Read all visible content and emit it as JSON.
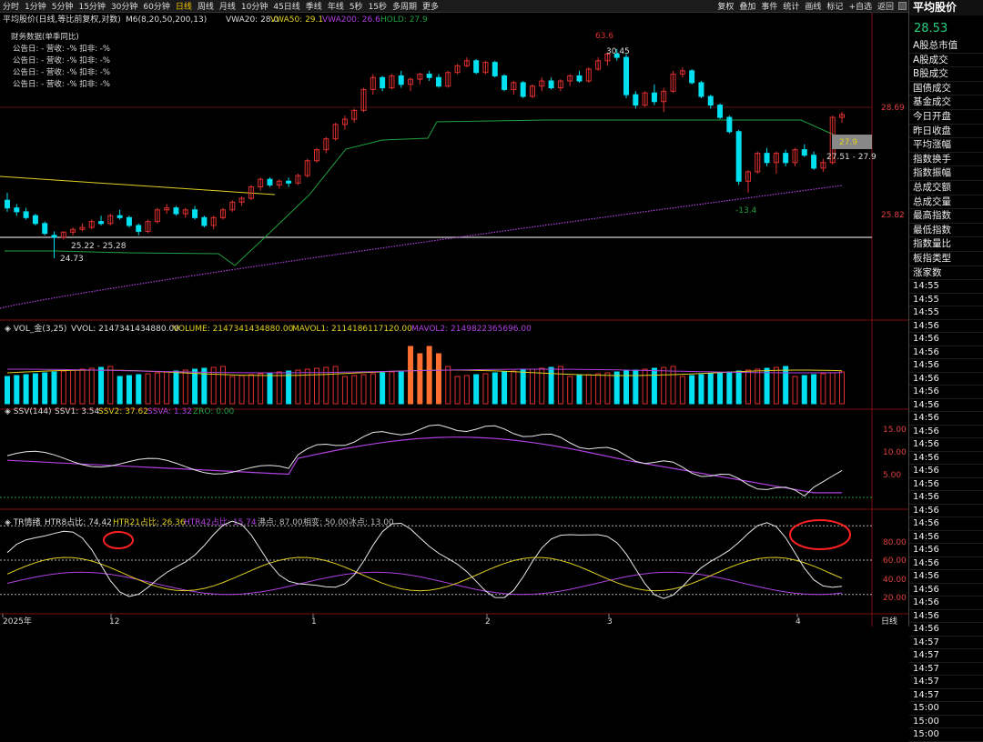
{
  "toolbar": {
    "periods": [
      {
        "label": "分时",
        "active": false
      },
      {
        "label": "1分钟",
        "active": false
      },
      {
        "label": "5分钟",
        "active": false
      },
      {
        "label": "15分钟",
        "active": false
      },
      {
        "label": "30分钟",
        "active": false
      },
      {
        "label": "60分钟",
        "active": false
      },
      {
        "label": "日线",
        "active": true
      },
      {
        "label": "周线",
        "active": false
      },
      {
        "label": "月线",
        "active": false
      },
      {
        "label": "10分钟",
        "active": false
      },
      {
        "label": "45日线",
        "active": false
      },
      {
        "label": "季线",
        "active": false
      },
      {
        "label": "年线",
        "active": false
      },
      {
        "label": "5秒",
        "active": false
      },
      {
        "label": "15秒",
        "active": false
      },
      {
        "label": "多周期",
        "active": false
      },
      {
        "label": "更多",
        "active": false
      }
    ],
    "tools": [
      "复权",
      "叠加",
      "事件",
      "统计",
      "画线",
      "标记",
      "+自选",
      "返回"
    ]
  },
  "main_panel": {
    "title": "平均股价(日线,等比前复权,对数)",
    "m6": "M6(8,20,50,200,13)",
    "vwa20": "VWA20: 28.0",
    "vwa50": "VWA50: 29.1",
    "vwa200": "VWA200: 26.6",
    "hold": "HOLD: 27.9",
    "fin_title": "财务数据(单季同比)",
    "fin_rows": [
      "公告日: -    营收: -%    扣非: -%",
      "公告日: -    营收: -%    扣非: -%",
      "公告日: -    营收: -%    扣非: -%",
      "公告日: -    营收: -%    扣非: -%"
    ],
    "ann_high_pct": "63.6",
    "ann_high": "30.45",
    "ann_low": "24.73",
    "ann_range1": "25.22 - 25.28",
    "ann_range2": "27.51 - 27.9",
    "ann_neg": "-13.4",
    "hold_tag": "27.9",
    "y_labels": [
      "28.69",
      "25.82"
    ]
  },
  "vol_panel": {
    "title": "VOL_金(3,25)",
    "vvol": "VVOL: 2147341434880.00",
    "volume": "VOLUME: 2147341434880.00",
    "mavol1": "MAVOL1: 2114186117120.00",
    "mavol2": "MAVOL2: 2149822365696.00"
  },
  "ssv_panel": {
    "title": "SSV(144)",
    "ssv1": "SSV1: 3.54",
    "ssv2": "SSV2: 37.62",
    "ssva": "SSVA: 1.32",
    "zro": "ZRO: 0.00",
    "y_labels": [
      "15.00",
      "10.00",
      "5.00"
    ]
  },
  "tr_panel": {
    "title": "TR情绪",
    "htr8": "HTR8占比: 74.42",
    "htr21": "HTR21占比: 26.36",
    "htr42": "HTR42占比: 15.74",
    "hot": "沸点: 87.00",
    "norm": "相变: 50.00",
    "ice": "冰点: 13.00",
    "y_labels": [
      "80.00",
      "60.00",
      "40.00",
      "20.00"
    ]
  },
  "x_axis": {
    "labels": [
      "2025年",
      "12",
      "1",
      "2",
      "3",
      "4"
    ],
    "period_label": "日线"
  },
  "colors": {
    "up": "#e03030",
    "down": "#00e0f0",
    "vwa20": "#20a040",
    "vwa50": "#e0d020",
    "vwa200": "#b040e0",
    "hold": "#d0d0d0",
    "highlight": "#ff7030",
    "circle": "#ff2020"
  },
  "right_panel": {
    "title": "平均股价",
    "price": "28.53",
    "items": [
      "A股总市值",
      "A股成交",
      "B股成交",
      "国债成交",
      "基金成交",
      "今日开盘",
      "昨日收盘",
      "平均涨幅",
      "指数换手",
      "指数振幅",
      "总成交额",
      "总成交量",
      "最高指数",
      "最低指数",
      "指数量比",
      "板指类型",
      "涨家数"
    ],
    "times": [
      "14:55",
      "14:55",
      "14:55",
      "14:56",
      "14:56",
      "14:56",
      "14:56",
      "14:56",
      "14:56",
      "14:56",
      "14:56",
      "14:56",
      "14:56",
      "14:56",
      "14:56",
      "14:56",
      "14:56",
      "14:56",
      "14:56",
      "14:56",
      "14:56",
      "14:56",
      "14:56",
      "14:56",
      "14:56",
      "14:56",
      "14:56",
      "14:57",
      "14:57",
      "14:57",
      "14:57",
      "14:57",
      "15:00",
      "15:00",
      "15:00"
    ]
  },
  "chart_data": {
    "type": "candlestick",
    "series": [
      {
        "name": "K",
        "ohlc": [
          [
            26.2,
            26.4,
            25.9,
            26.0
          ],
          [
            26.0,
            26.1,
            25.8,
            25.9
          ],
          [
            25.9,
            26.0,
            25.7,
            25.75
          ],
          [
            25.8,
            25.85,
            25.55,
            25.6
          ],
          [
            25.6,
            25.65,
            25.3,
            25.35
          ],
          [
            25.3,
            25.4,
            24.73,
            25.25
          ],
          [
            25.25,
            25.4,
            25.2,
            25.38
          ],
          [
            25.38,
            25.5,
            25.3,
            25.45
          ],
          [
            25.45,
            25.6,
            25.4,
            25.5
          ],
          [
            25.5,
            25.7,
            25.45,
            25.65
          ],
          [
            25.65,
            25.8,
            25.55,
            25.6
          ],
          [
            25.6,
            25.85,
            25.55,
            25.8
          ],
          [
            25.8,
            25.95,
            25.7,
            25.75
          ],
          [
            25.75,
            25.8,
            25.5,
            25.55
          ],
          [
            25.55,
            25.6,
            25.3,
            25.4
          ],
          [
            25.4,
            25.7,
            25.35,
            25.65
          ],
          [
            25.65,
            26.0,
            25.6,
            25.95
          ],
          [
            25.95,
            26.1,
            25.85,
            26.0
          ],
          [
            26.0,
            26.05,
            25.8,
            25.85
          ],
          [
            25.85,
            26.0,
            25.75,
            25.95
          ],
          [
            25.95,
            26.05,
            25.7,
            25.75
          ],
          [
            25.75,
            25.8,
            25.5,
            25.55
          ],
          [
            25.55,
            25.8,
            25.45,
            25.75
          ],
          [
            25.75,
            26.0,
            25.7,
            25.95
          ],
          [
            25.95,
            26.2,
            25.9,
            26.15
          ],
          [
            26.15,
            26.3,
            26.05,
            26.25
          ],
          [
            26.25,
            26.6,
            26.2,
            26.55
          ],
          [
            26.55,
            26.8,
            26.45,
            26.75
          ],
          [
            26.75,
            26.8,
            26.55,
            26.6
          ],
          [
            26.6,
            26.75,
            26.5,
            26.7
          ],
          [
            26.7,
            26.8,
            26.55,
            26.65
          ],
          [
            26.65,
            26.9,
            26.6,
            26.85
          ],
          [
            26.85,
            27.3,
            26.8,
            27.25
          ],
          [
            27.25,
            27.6,
            27.2,
            27.55
          ],
          [
            27.55,
            27.9,
            27.45,
            27.85
          ],
          [
            27.85,
            28.3,
            27.8,
            28.25
          ],
          [
            28.25,
            28.5,
            28.1,
            28.4
          ],
          [
            28.4,
            28.7,
            28.3,
            28.65
          ],
          [
            28.65,
            29.3,
            28.6,
            29.25
          ],
          [
            29.25,
            29.7,
            29.1,
            29.6
          ],
          [
            29.6,
            29.65,
            29.2,
            29.3
          ],
          [
            29.3,
            29.7,
            29.25,
            29.65
          ],
          [
            29.65,
            29.8,
            29.3,
            29.4
          ],
          [
            29.4,
            29.6,
            29.2,
            29.55
          ],
          [
            29.55,
            29.75,
            29.4,
            29.7
          ],
          [
            29.7,
            29.8,
            29.5,
            29.6
          ],
          [
            29.6,
            29.7,
            29.3,
            29.35
          ],
          [
            29.35,
            29.8,
            29.3,
            29.75
          ],
          [
            29.75,
            30.0,
            29.7,
            29.95
          ],
          [
            29.95,
            30.2,
            29.9,
            30.1
          ],
          [
            30.1,
            30.15,
            29.7,
            29.75
          ],
          [
            29.75,
            30.1,
            29.7,
            30.05
          ],
          [
            30.05,
            30.1,
            29.6,
            29.65
          ],
          [
            29.65,
            29.7,
            29.2,
            29.25
          ],
          [
            29.25,
            29.5,
            29.1,
            29.45
          ],
          [
            29.45,
            29.5,
            29.0,
            29.05
          ],
          [
            29.05,
            29.4,
            29.0,
            29.35
          ],
          [
            29.35,
            29.6,
            29.2,
            29.5
          ],
          [
            29.5,
            29.6,
            29.25,
            29.3
          ],
          [
            29.3,
            29.55,
            29.2,
            29.5
          ],
          [
            29.5,
            29.7,
            29.35,
            29.65
          ],
          [
            29.65,
            29.8,
            29.45,
            29.5
          ],
          [
            29.5,
            29.9,
            29.45,
            29.85
          ],
          [
            29.85,
            30.2,
            29.8,
            30.1
          ],
          [
            30.1,
            30.35,
            29.95,
            30.3
          ],
          [
            30.3,
            30.45,
            30.1,
            30.2
          ],
          [
            30.2,
            30.3,
            29.0,
            29.1
          ],
          [
            29.1,
            29.2,
            28.7,
            28.8
          ],
          [
            28.8,
            29.2,
            28.75,
            29.15
          ],
          [
            29.15,
            29.4,
            28.8,
            28.9
          ],
          [
            28.9,
            29.3,
            28.6,
            29.2
          ],
          [
            29.2,
            29.8,
            29.15,
            29.7
          ],
          [
            29.7,
            29.9,
            29.6,
            29.8
          ],
          [
            29.8,
            29.85,
            29.4,
            29.45
          ],
          [
            29.45,
            29.5,
            29.0,
            29.05
          ],
          [
            29.05,
            29.1,
            28.7,
            28.8
          ],
          [
            28.8,
            28.85,
            28.4,
            28.45
          ],
          [
            28.45,
            28.5,
            28.0,
            28.05
          ],
          [
            28.05,
            28.1,
            26.6,
            26.7
          ],
          [
            26.7,
            27.0,
            26.4,
            26.95
          ],
          [
            26.95,
            27.5,
            26.9,
            27.45
          ],
          [
            27.45,
            27.6,
            27.1,
            27.2
          ],
          [
            27.2,
            27.5,
            26.9,
            27.45
          ],
          [
            27.45,
            27.55,
            27.1,
            27.2
          ],
          [
            27.2,
            27.6,
            27.1,
            27.55
          ],
          [
            27.55,
            27.7,
            27.35,
            27.4
          ],
          [
            27.4,
            27.5,
            27.0,
            27.05
          ],
          [
            27.05,
            27.3,
            26.95,
            27.2
          ],
          [
            27.2,
            28.5,
            27.15,
            28.45
          ],
          [
            28.45,
            28.6,
            28.3,
            28.53
          ]
        ]
      }
    ]
  }
}
